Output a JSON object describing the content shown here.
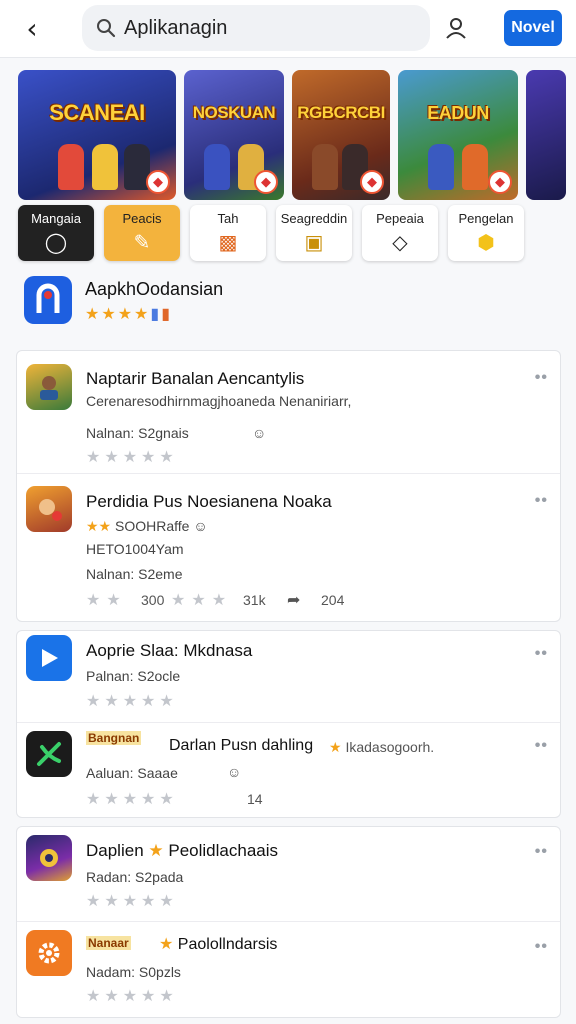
{
  "header": {
    "search_value": "Aplikanagin",
    "novel_label": "Novel"
  },
  "banners": [
    {
      "title": "SCANEAI",
      "bg": "#2c3e9a"
    },
    {
      "title": "NOSKUAN",
      "bg": "#4a4fb8"
    },
    {
      "title": "RGBCRCBI",
      "bg": "#a0522d"
    },
    {
      "title": "EADUN",
      "bg": "#3c8a3c"
    }
  ],
  "categories": [
    {
      "label": "Mangaia",
      "icon": "chat-icon"
    },
    {
      "label": "Peacis",
      "icon": "pencil-icon"
    },
    {
      "label": "Tah",
      "icon": "game-icon"
    },
    {
      "label": "Seagreddin",
      "icon": "card-icon"
    },
    {
      "label": "Pepeaia",
      "icon": "comment-icon"
    },
    {
      "label": "Pengelan",
      "icon": "puzzle-icon"
    }
  ],
  "featured": {
    "name": "AapkhOodansian",
    "rating": 4
  },
  "list_group_1": [
    {
      "name": "Naptarir Banalan Aencantylis",
      "line1": "Cerenaresodhirnmagjhoaneda Nenaniriarr,",
      "line2": "Nalnan: S2gnais",
      "icon": "game-art-icon",
      "color": "#3a7a3a"
    },
    {
      "name": "Perdidia Pus Noesianena Noaka",
      "line1": "SOOHRaffe",
      "line2": "HETO1004Yam",
      "line3": "Nalnan: S2eme",
      "meta1": "300",
      "meta2": "31k",
      "meta3": "204",
      "icon": "game-art-icon",
      "color": "#e08a2a"
    }
  ],
  "list_group_2": [
    {
      "name": "Aoprie Slaa: Mkdnasa",
      "line1": "Palnan: S2ocle",
      "icon": "play-icon",
      "color": "#1a73e8"
    },
    {
      "name": "Darlan Pusn dahling",
      "tag": "Bangnan",
      "extra": "Ikadasogoorh.",
      "line1": "Aaluan: Saaae",
      "meta1": "14",
      "icon": "cross-leaf-icon",
      "color": "#1b5e20"
    }
  ],
  "list_group_3": [
    {
      "name": "Daplien",
      "extra": "Peolidlachaais",
      "line1": "Radan: S2pada",
      "icon": "game-art-icon",
      "color": "#7b2da8"
    },
    {
      "name": "Paolollndarsis",
      "tag": "Nanaar",
      "line1": "Nadam: S0pzls",
      "icon": "gear-icon",
      "color": "#f07a22"
    }
  ]
}
